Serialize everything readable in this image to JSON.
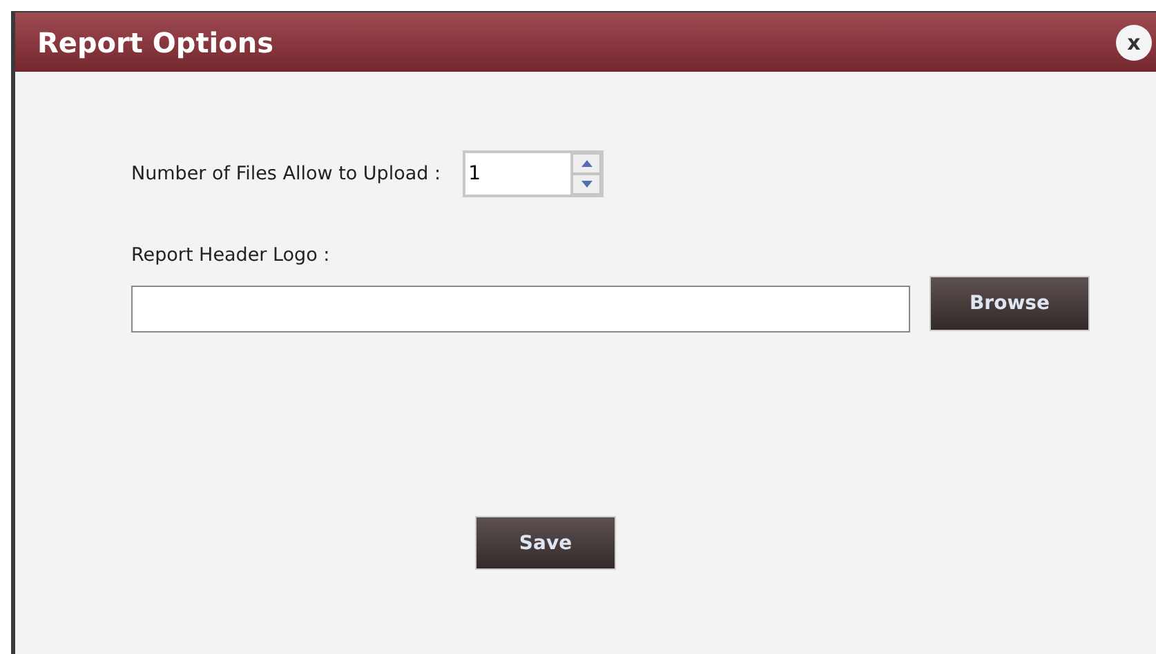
{
  "window": {
    "title": "Report Options",
    "close": "x"
  },
  "files_count": {
    "label": "Number of Files Allow to Upload :",
    "value": "1"
  },
  "header_logo": {
    "label": "Report Header Logo :",
    "browse": "Browse"
  },
  "buttons": {
    "save": "Save"
  }
}
